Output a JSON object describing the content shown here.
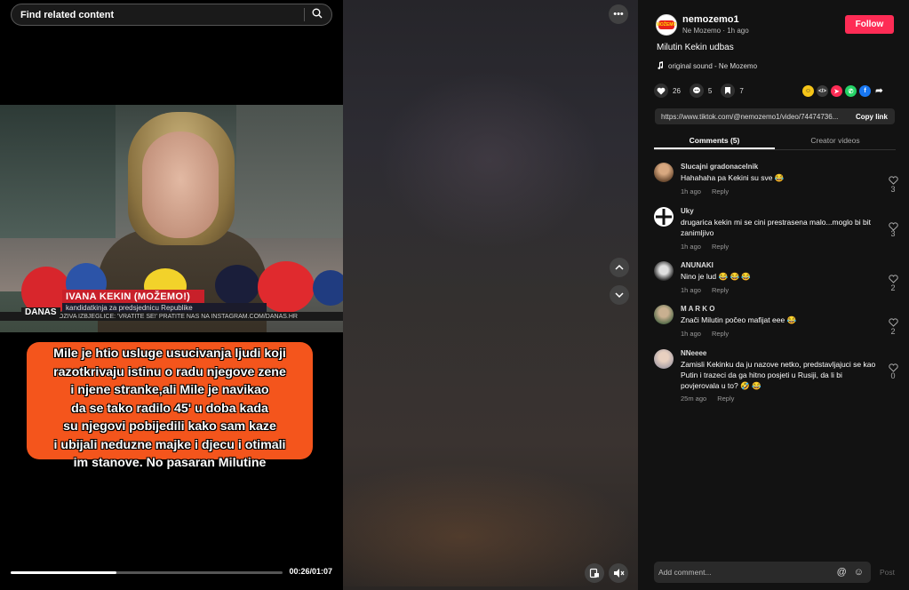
{
  "search": {
    "placeholder": "Find related content"
  },
  "video": {
    "news_name": "IVANA KEKIN (MOŽEMO!)",
    "news_subtitle": "kandidatkinja za predsjednicu Republike",
    "ticker": "OZIVA IZBJEGLICE: 'VRATITE SE!'          PRATITE NAS NA INSTAGRAM.COM/DANAS.HR",
    "channel": "DANAS",
    "caption_lines": [
      "Mile je htio usluge usucivanja ljudi koji",
      "razotkrivaju istinu o radu njegove zene",
      "i njene stranke,ali Mile je navikao",
      "da se tako radilo 45' u doba kada",
      "su njegovi pobijedili kako sam kaze",
      "i ubijali neduzne majke i djecu i otimali",
      "im stanove. No pasaran Milutine"
    ],
    "time": "00:26/01:07",
    "progress": 0.39
  },
  "author": {
    "username": "nemozemo1",
    "display_name": "Ne Mozemo",
    "posted": "1h ago",
    "sub_line": "Ne Mozemo · 1h ago",
    "logo_text": "MOŽEMO"
  },
  "follow_label": "Follow",
  "description": "Milutin Kekin udbas",
  "sound": "original sound - Ne Mozemo",
  "stats": {
    "likes": "26",
    "comments": "5",
    "saves": "7"
  },
  "link": {
    "url": "https://www.tiktok.com/@nemozemo1/video/74474736...",
    "copy_label": "Copy link"
  },
  "tabs": [
    "Comments (5)",
    "Creator videos"
  ],
  "comments": [
    {
      "name": "Slucajni gradonacelnik",
      "text": "Hahahaha pa Kekini su sve 😂",
      "time": "1h ago",
      "reply": "Reply",
      "likes": "3"
    },
    {
      "name": "Uky",
      "text": "drugarica kekin mi se cini prestrasena malo...moglo bi bit zanimljivo",
      "time": "1h ago",
      "reply": "Reply",
      "likes": "3"
    },
    {
      "name": "ANUNAKI",
      "text": "Nino je lud 😂 😂 😂",
      "time": "1h ago",
      "reply": "Reply",
      "likes": "2"
    },
    {
      "name": "M A R K O",
      "text": "Znači Milutin počeo mafijat eee 😂",
      "time": "1h ago",
      "reply": "Reply",
      "likes": "2"
    },
    {
      "name": "NNeeee",
      "text": "Zamisli Kekinku da ju nazove netko, predstavljajuci se kao Putin i trazeci da ga hitno posjeti u Rusiji, da li bi povjerovala u to? 🤣 😂",
      "time": "25m ago",
      "reply": "Reply",
      "likes": "0"
    }
  ],
  "input": {
    "placeholder": "Add comment...",
    "post_label": "Post"
  },
  "colors": {
    "accent": "#fe2c55",
    "caption_bg": "#f4551c",
    "panel_bg": "#121212"
  }
}
